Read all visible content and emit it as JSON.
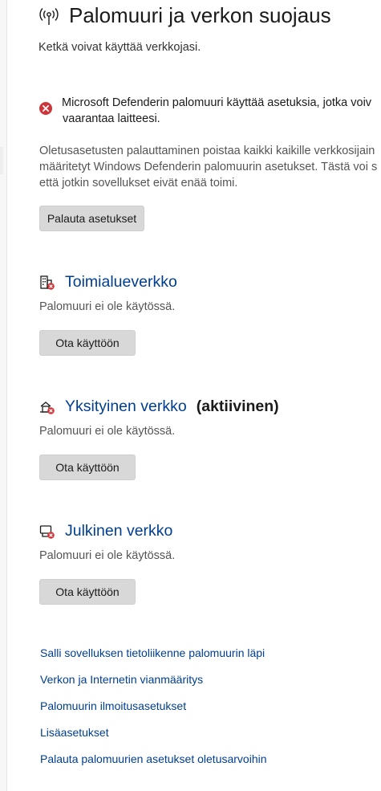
{
  "page": {
    "title": "Palomuuri ja verkon suojaus",
    "subtitle": "Ketkä voivat käyttää verkkojasi."
  },
  "warning": {
    "line1": "Microsoft Defenderin palomuuri käyttää asetuksia, jotka voiv",
    "line2": "vaarantaa laitteesi."
  },
  "info": {
    "line1": "Oletusasetusten palauttaminen poistaa kaikki kaikille verkkosijain",
    "line2": "määritetyt Windows Defenderin palomuurin asetukset. Tästä voi s",
    "line3": "että jotkin sovellukset eivät enää toimi."
  },
  "restore_button": "Palauta asetukset",
  "networks": [
    {
      "name": "Toimialueverkko",
      "active": "",
      "status": "Palomuuri ei ole käytössä.",
      "button": "Ota käyttöön",
      "icon": "domain-network-icon"
    },
    {
      "name": "Yksityinen verkko",
      "active": "(aktiivinen)",
      "status": "Palomuuri ei ole käytössä.",
      "button": "Ota käyttöön",
      "icon": "private-network-icon"
    },
    {
      "name": "Julkinen verkko",
      "active": "",
      "status": "Palomuuri ei ole käytössä.",
      "button": "Ota käyttöön",
      "icon": "public-network-icon"
    }
  ],
  "links": [
    "Salli sovelluksen tietoliikenne palomuurin läpi",
    "Verkon ja Internetin vianmääritys",
    "Palomuurin ilmoitusasetukset",
    "Lisäasetukset",
    "Palauta palomuurien asetukset oletusarvoihin"
  ],
  "colors": {
    "link": "#003e92",
    "error": "#d13438",
    "button_bg": "#d8d8d8"
  }
}
